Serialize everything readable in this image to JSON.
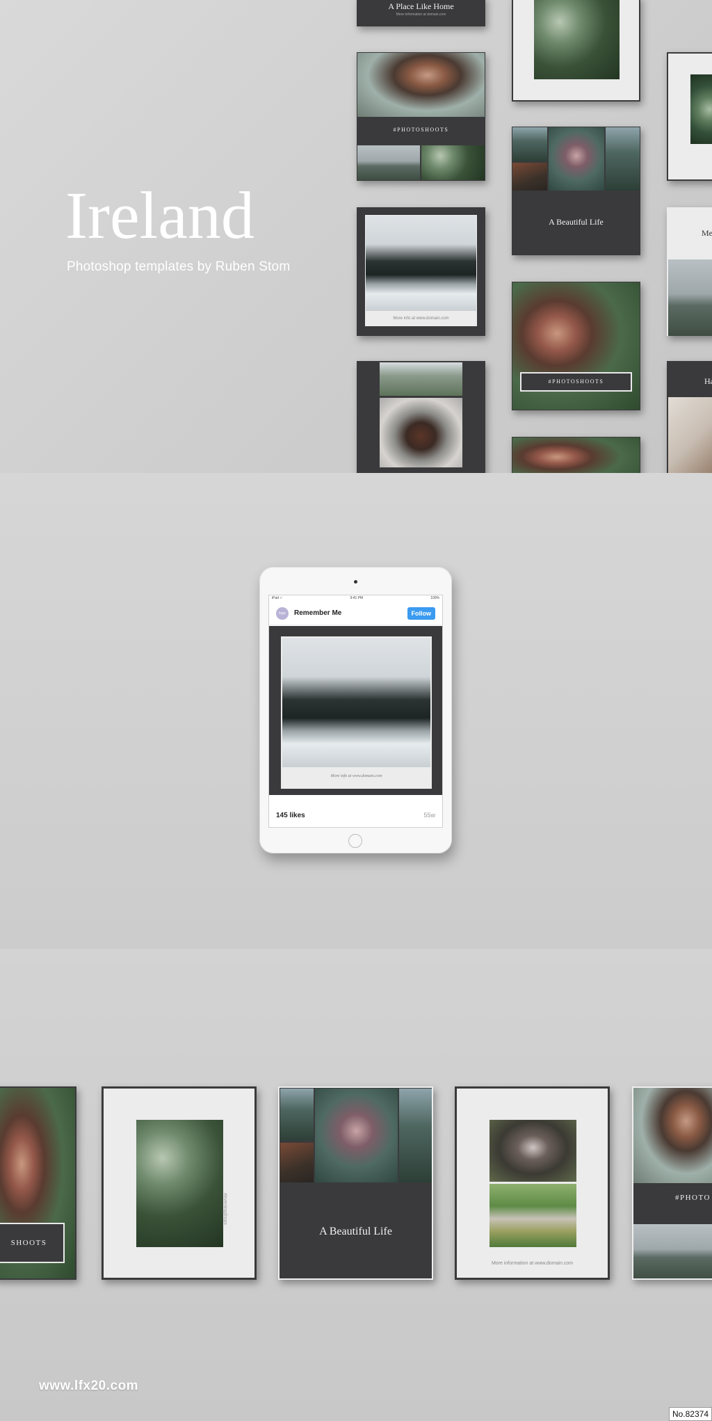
{
  "hero": {
    "title": "Ireland",
    "subtitle": "Photoshop templates by Ruben Stom"
  },
  "cards": {
    "place_like_home": "A Place Like Home",
    "place_like_home_sub": "More information at domain.com",
    "photoshoots": "#PHOTOSHOOTS",
    "beautiful_life": "A Beautiful Life",
    "more_info": "More information at www.domain.com",
    "vertical_tag": "#eveningdrops",
    "partial_me": "Me",
    "partial_ha": "Ha",
    "partial_photo": "#PHOTO",
    "partial_shoots": "SHOOTS"
  },
  "ipad": {
    "status_left": "iPad ✓",
    "status_center": "9:41 PM",
    "status_right": "100%",
    "avatar_text": "logo",
    "username": "Remember Me",
    "follow_label": "Follow",
    "post_caption": "More info at www.domain.com",
    "likes": "145 likes",
    "time": "55w"
  },
  "footer": {
    "watermark": "www.lfx20.com",
    "badge": "No.82374"
  }
}
